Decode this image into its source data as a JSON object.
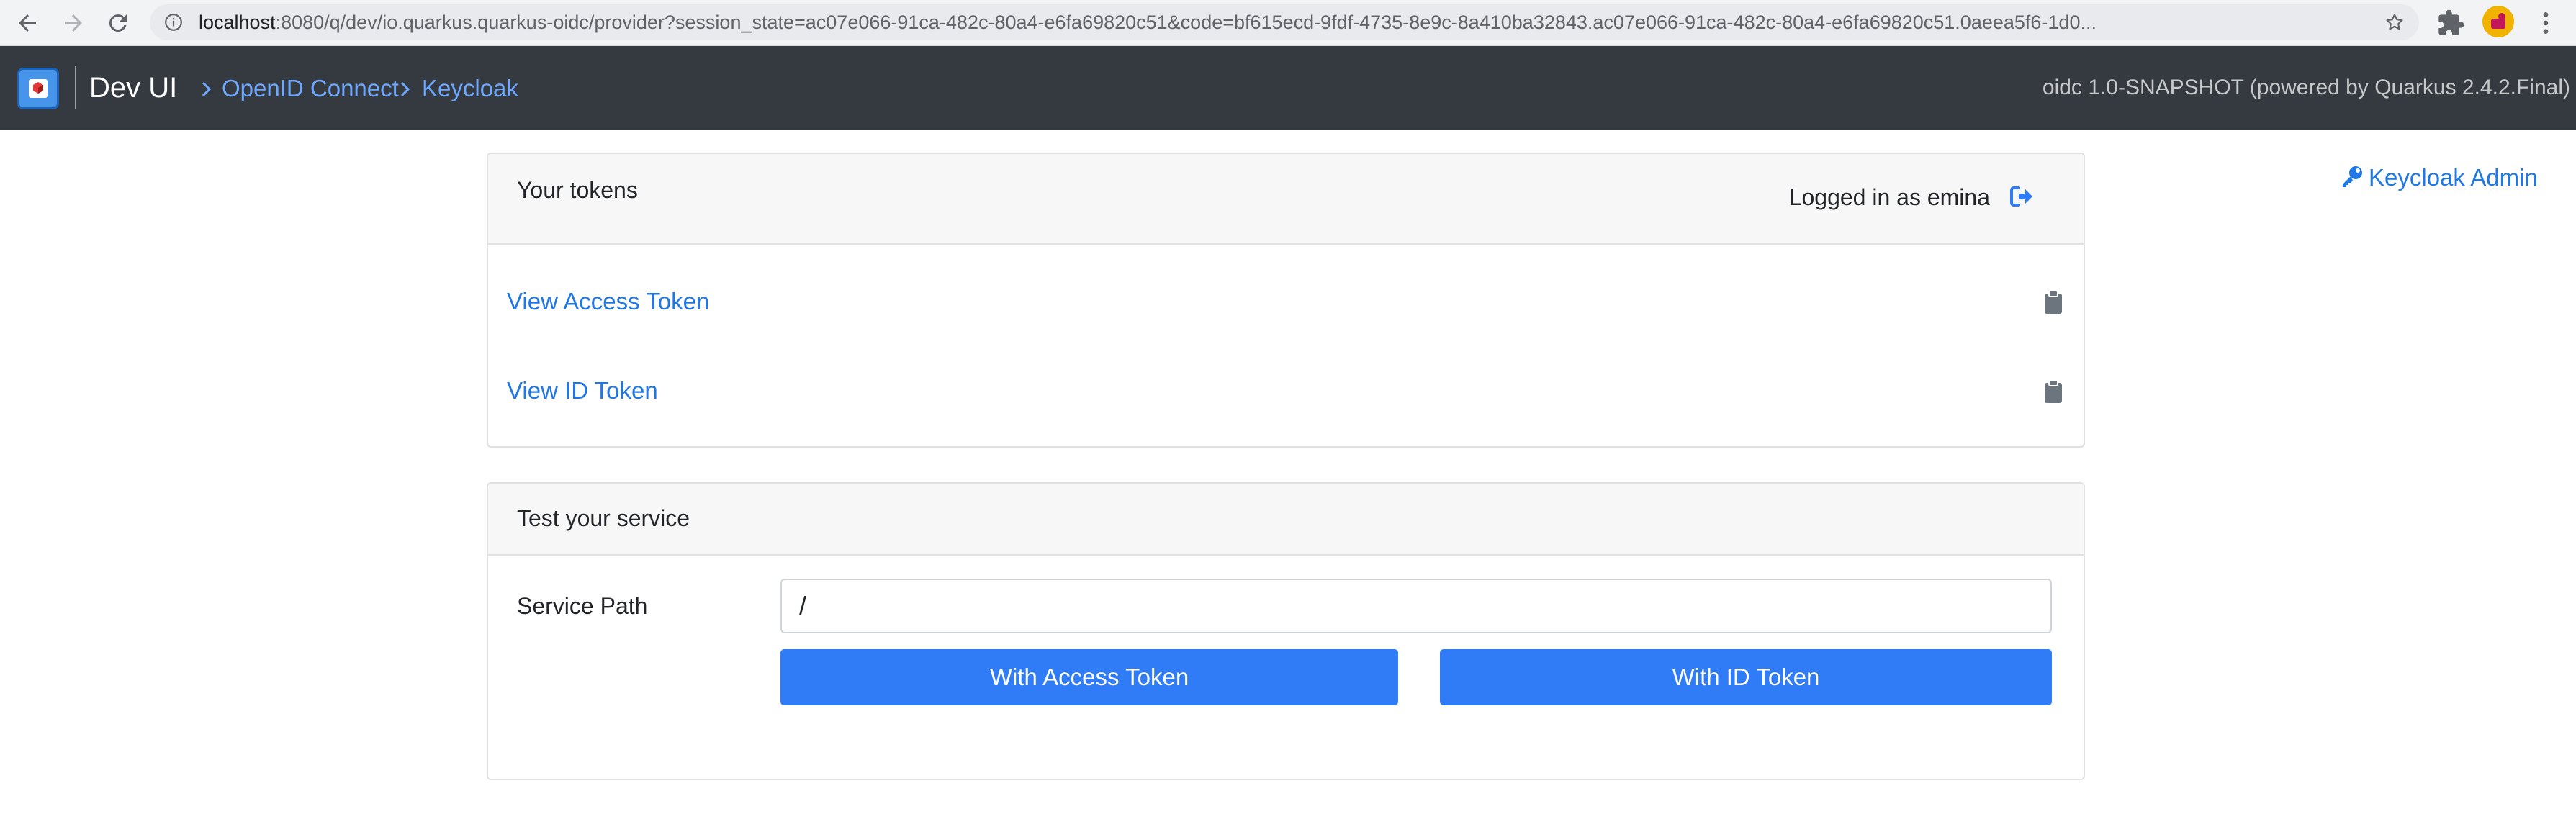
{
  "browser": {
    "url_host": "localhost",
    "url_rest": ":8080/q/dev/io.quarkus.quarkus-oidc/provider?session_state=ac07e066-91ca-482c-80a4-e6fa69820c51&code=bf615ecd-9fdf-4735-8e9c-8a410ba32843.ac07e066-91ca-482c-80a4-e6fa69820c51.0aeea5f6-1d0..."
  },
  "header": {
    "title": "Dev UI",
    "breadcrumbs": [
      "OpenID Connect",
      "Keycloak"
    ],
    "version": "oidc 1.0-SNAPSHOT (powered by Quarkus 2.4.2.Final)"
  },
  "tokens_card": {
    "title": "Your tokens",
    "logged_in": "Logged in as emina",
    "links": [
      "View Access Token",
      "View ID Token"
    ]
  },
  "service_card": {
    "title": "Test your service",
    "path_label": "Service Path",
    "path_value": "/",
    "buttons": [
      "With Access Token",
      "With ID Token"
    ]
  },
  "keycloak_admin": "Keycloak Admin",
  "colors": {
    "navbar": "#343a40",
    "link": "#1f78e6",
    "button": "#2f7cf6",
    "breadcrumb": "#6fa8ff"
  },
  "icons": {
    "logout": "sign-out-icon",
    "copy": "clipboard-icon",
    "admin": "key-icon"
  }
}
